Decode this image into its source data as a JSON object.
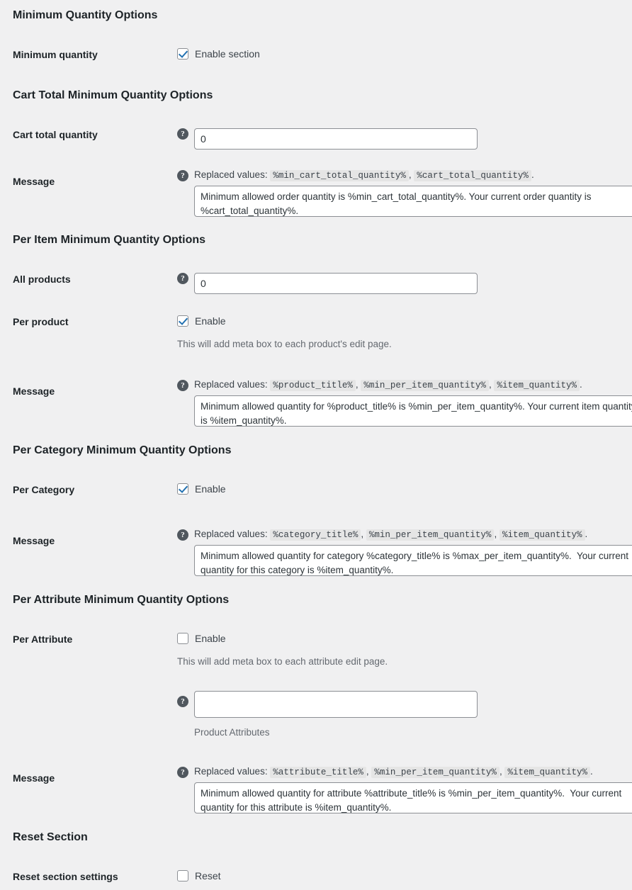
{
  "sections": [
    {
      "id": "minimum-quantity-options",
      "heading": "Minimum Quantity Options",
      "rows": [
        {
          "id": "minimum-quantity",
          "label": "Minimum quantity",
          "checkbox_label": "Enable section",
          "checked": true
        }
      ]
    },
    {
      "id": "cart-total-minimum-quantity-options",
      "heading": "Cart Total Minimum Quantity Options",
      "rows": [
        {
          "id": "cart-total-quantity",
          "label": "Cart total quantity",
          "value": "0",
          "placeholder": ""
        },
        {
          "id": "cart-total-message",
          "label": "Message",
          "replaced_prefix": "Replaced values:",
          "tokens": [
            "%min_cart_total_quantity%",
            "%cart_total_quantity%"
          ],
          "value": "Minimum allowed order quantity is %min_cart_total_quantity%. Your current order quantity is %cart_total_quantity%."
        }
      ]
    },
    {
      "id": "per-item-minimum-quantity-options",
      "heading": "Per Item Minimum Quantity Options",
      "rows": [
        {
          "id": "all-products",
          "label": "All products",
          "value": "0",
          "placeholder": ""
        },
        {
          "id": "per-product",
          "label": "Per product",
          "checkbox_label": "Enable",
          "checked": true,
          "description": "This will add meta box to each product's edit page."
        },
        {
          "id": "per-item-message",
          "label": "Message",
          "replaced_prefix": "Replaced values:",
          "tokens": [
            "%product_title%",
            "%min_per_item_quantity%",
            "%item_quantity%"
          ],
          "value": "Minimum allowed quantity for %product_title% is %min_per_item_quantity%. Your current item quantity is %item_quantity%."
        }
      ]
    },
    {
      "id": "per-category-minimum-quantity-options",
      "heading": "Per Category Minimum Quantity Options",
      "rows": [
        {
          "id": "per-category",
          "label": "Per Category",
          "checkbox_label": "Enable",
          "checked": true
        },
        {
          "id": "per-category-message",
          "label": "Message",
          "replaced_prefix": "Replaced values:",
          "tokens": [
            "%category_title%",
            "%min_per_item_quantity%",
            "%item_quantity%"
          ],
          "value": "Minimum allowed quantity for category %category_title% is %max_per_item_quantity%.  Your current quantity for this category is %item_quantity%."
        }
      ]
    },
    {
      "id": "per-attribute-minimum-quantity-options",
      "heading": "Per Attribute Minimum Quantity Options",
      "rows": [
        {
          "id": "per-attribute",
          "label": "Per Attribute",
          "checkbox_label": "Enable",
          "checked": false,
          "description": "This will add meta box to each attribute edit page."
        },
        {
          "id": "product-attributes",
          "label": "",
          "value": "",
          "placeholder": "",
          "description": "Product Attributes"
        },
        {
          "id": "per-attribute-message",
          "label": "Message",
          "replaced_prefix": "Replaced values:",
          "tokens": [
            "%attribute_title%",
            "%min_per_item_quantity%",
            "%item_quantity%"
          ],
          "value": "Minimum allowed quantity for attribute %attribute_title% is %min_per_item_quantity%.  Your current quantity for this attribute is %item_quantity%."
        }
      ]
    },
    {
      "id": "reset-section",
      "heading": "Reset Section",
      "rows": [
        {
          "id": "reset-section-settings",
          "label": "Reset section settings",
          "checkbox_label": "Reset",
          "checked": false
        }
      ]
    }
  ],
  "icons": {
    "help": "?"
  },
  "colors": {
    "background": "#f0f0f1",
    "heading": "#1d2327",
    "label": "#1d2327",
    "text": "#3c434a",
    "muted": "#646970",
    "border": "#8c8f94",
    "accent": "#2271b1",
    "token_bg": "#e5e5e5"
  }
}
